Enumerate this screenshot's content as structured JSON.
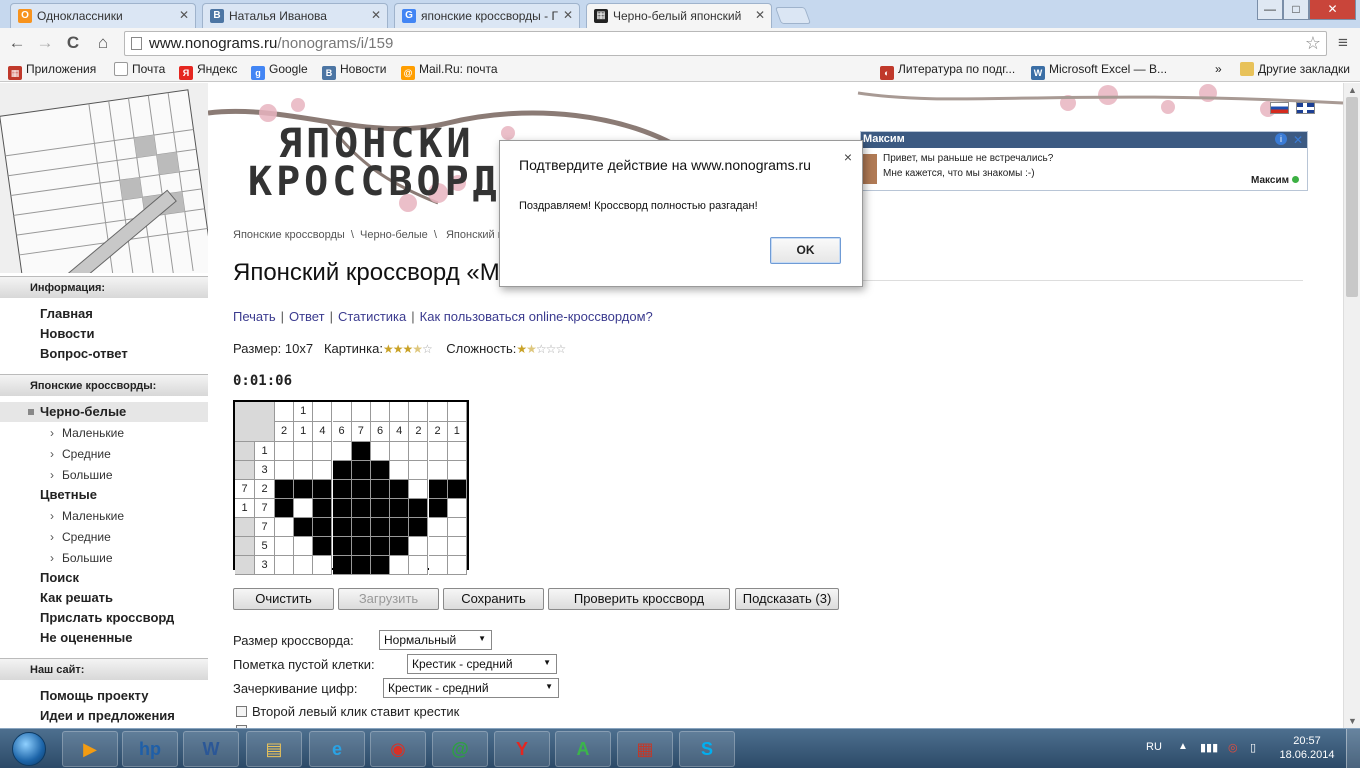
{
  "browser": {
    "tabs": [
      {
        "label": "Одноклассники",
        "icon": "odnoklassniki-icon",
        "color": "#f7931e",
        "glyph": "О"
      },
      {
        "label": "Наталья Иванова",
        "icon": "vk-icon",
        "color": "#4c75a3",
        "glyph": "В"
      },
      {
        "label": "японские кроссворды - Г",
        "icon": "google-icon",
        "color": "#4285f4",
        "glyph": "G"
      },
      {
        "label": "Черно-белый японский",
        "icon": "nonograms-icon",
        "color": "#222222",
        "glyph": "▦"
      }
    ],
    "window_buttons": {
      "minimize": "—",
      "maximize": "□",
      "close": "✕"
    },
    "nav": {
      "back": "←",
      "forward": "→",
      "reload": "C",
      "home": "⌂",
      "menu": "≡"
    },
    "url_host": "www.nonograms.ru",
    "url_path": "/nonograms/i/159",
    "bookmarks": [
      {
        "label": "Приложения",
        "color": "#c0392b",
        "glyph": "▦"
      },
      {
        "label": "Почта",
        "color": "#999999",
        "glyph": ""
      },
      {
        "label": "Яндекс",
        "color": "#e52620",
        "glyph": "Я"
      },
      {
        "label": "Google",
        "color": "#4285f4",
        "glyph": "g"
      },
      {
        "label": "Новости",
        "color": "#4c75a3",
        "glyph": "В"
      },
      {
        "label": "Mail.Ru: почта",
        "color": "#ff9e00",
        "glyph": "@"
      }
    ],
    "bookmarks_right": [
      {
        "label": "Литература по подг...",
        "color": "#c0392b",
        "glyph": "◐"
      },
      {
        "label": "Microsoft Excel — В...",
        "color": "#3b6ea5",
        "glyph": "W"
      }
    ],
    "bookmarks_more": "»",
    "other_bookmarks": "Другие закладки"
  },
  "sidebar": {
    "sections": [
      {
        "title": "Информация:"
      },
      {
        "title": "Японские кроссворды:"
      },
      {
        "title": "Наш сайт:"
      }
    ],
    "info_links": [
      "Главная",
      "Новости",
      "Вопрос-ответ"
    ],
    "bw": "Черно-белые",
    "bw_subs": [
      "Маленькие",
      "Средние",
      "Большие"
    ],
    "color": "Цветные",
    "color_subs": [
      "Маленькие",
      "Средние",
      "Большие"
    ],
    "more_links": [
      "Поиск",
      "Как решать",
      "Прислать кроссворд",
      "Не оцененные"
    ],
    "site_links": [
      "Помощь проекту",
      "Идеи и предложения"
    ]
  },
  "header": {
    "logo_line1": "ЯПОНСКИ",
    "logo_line2": "КРОССВОРД"
  },
  "ad": {
    "name": "Максим",
    "line1": "Привет, мы раньше не встречались?",
    "line2": "Мне кажется, что мы знакомы :-)",
    "footer_name": "Максим"
  },
  "breadcrumb": [
    "Японские кроссворды",
    "Черно-белые",
    "Японский кроссворд «Маленький чайник»"
  ],
  "breadcrumb_sep": "\\",
  "title": "Японский кроссворд «Маленький чайник»",
  "links": [
    "Печать",
    "Ответ",
    "Статистика",
    "Как пользоваться online-кроссвордом?"
  ],
  "info": {
    "size_label": "Размер:",
    "size_value": "10x7",
    "picture_label": "Картинка:",
    "picture_rating": 3.5,
    "difficulty_label": "Сложность:",
    "difficulty_rating": 1.5
  },
  "timer": "0:01:06",
  "nonogram": {
    "col_clues_top": [
      "",
      "1",
      "",
      "",
      "",
      "",
      "",
      "",
      "",
      ""
    ],
    "col_clues_bottom": [
      "2",
      "1",
      "4",
      "6",
      "7",
      "6",
      "4",
      "2",
      "2",
      "1"
    ],
    "row_clues": [
      [
        "",
        "1"
      ],
      [
        "",
        "3"
      ],
      [
        "7",
        "2"
      ],
      [
        "1",
        "7"
      ],
      [
        "",
        "7"
      ],
      [
        "",
        "5"
      ],
      [
        "",
        "3"
      ]
    ],
    "grid": [
      [
        0,
        0,
        0,
        0,
        1,
        0,
        0,
        0,
        0,
        0
      ],
      [
        0,
        0,
        0,
        1,
        1,
        1,
        0,
        0,
        0,
        0
      ],
      [
        1,
        1,
        1,
        1,
        1,
        1,
        1,
        0,
        1,
        1
      ],
      [
        1,
        0,
        1,
        1,
        1,
        1,
        1,
        1,
        1,
        0
      ],
      [
        0,
        1,
        1,
        1,
        1,
        1,
        1,
        1,
        0,
        0
      ],
      [
        0,
        0,
        1,
        1,
        1,
        1,
        1,
        0,
        0,
        0
      ],
      [
        0,
        0,
        0,
        1,
        1,
        1,
        0,
        0,
        0,
        0
      ]
    ]
  },
  "buttons": {
    "clear": "Очистить",
    "load": "Загрузить",
    "save": "Сохранить",
    "check": "Проверить кроссворд",
    "hint": "Подсказать (3)"
  },
  "options": {
    "size_label": "Размер кроссворда:",
    "size_value": "Нормальный",
    "mark_label": "Пометка пустой клетки:",
    "mark_value": "Крестик - средний",
    "strike_label": "Зачеркивание цифр:",
    "strike_value": "Крестик - средний",
    "checkbox1": "Второй левый клик ставит крестик"
  },
  "dialog": {
    "title": "Подтвердите действие на www.nonograms.ru",
    "message": "Поздравляем! Кроссворд полностью разгадан!",
    "ok": "OK",
    "close": "×"
  },
  "taskbar": {
    "apps": [
      {
        "name": "media-player",
        "glyph": "▶",
        "color": "#f39c12"
      },
      {
        "name": "hp",
        "glyph": "hp",
        "color": "#1f5fa8"
      },
      {
        "name": "word",
        "glyph": "W",
        "color": "#2b5797"
      },
      {
        "name": "explorer",
        "glyph": "▤",
        "color": "#e8c25a"
      },
      {
        "name": "ie",
        "glyph": "e",
        "color": "#2aa3e5"
      },
      {
        "name": "chrome",
        "glyph": "◉",
        "color": "#d93025"
      },
      {
        "name": "icq",
        "glyph": "@",
        "color": "#2ea043"
      },
      {
        "name": "yandex-browser",
        "glyph": "Y",
        "color": "#e52620"
      },
      {
        "name": "acrobat",
        "glyph": "A",
        "color": "#3bb54a"
      },
      {
        "name": "paint",
        "glyph": "▦",
        "color": "#c0392b"
      },
      {
        "name": "skype",
        "glyph": "S",
        "color": "#00aff0"
      }
    ],
    "lang": "RU",
    "time": "20:57",
    "date": "18.06.2014"
  }
}
